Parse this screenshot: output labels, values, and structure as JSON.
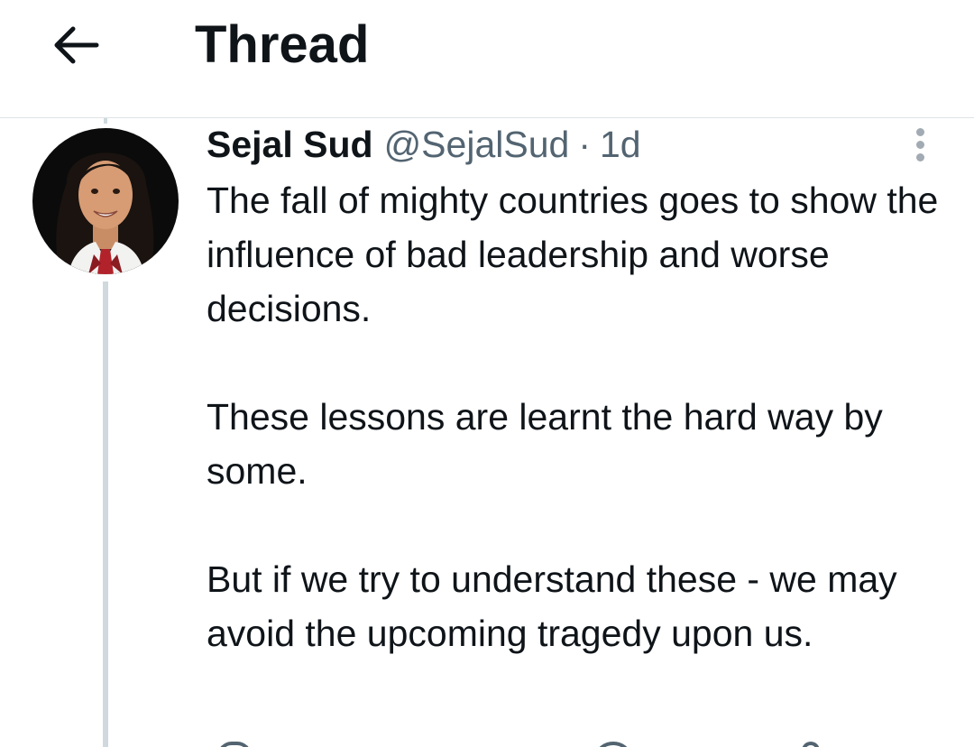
{
  "header": {
    "title": "Thread",
    "back_icon": "arrow-left-icon"
  },
  "tweet": {
    "author": {
      "display_name": "Sejal Sud",
      "handle": "@SejalSud",
      "avatar_icon": "profile-photo"
    },
    "separator": "·",
    "timestamp": "1d",
    "more_icon": "more-vertical-icon",
    "paragraphs": [
      "The fall of mighty countries goes to show the influence of bad leadership and worse decisions.",
      "These lessons are learnt the hard way by some.",
      "But if we try to understand these - we may avoid the upcoming tragedy upon us."
    ],
    "actions": [
      "reply-icon",
      "like-icon",
      "share-icon"
    ]
  },
  "colors": {
    "text_primary": "#0f1419",
    "text_secondary": "#536471",
    "thread_line": "#cfd9de",
    "divider": "#dfe3e6"
  }
}
